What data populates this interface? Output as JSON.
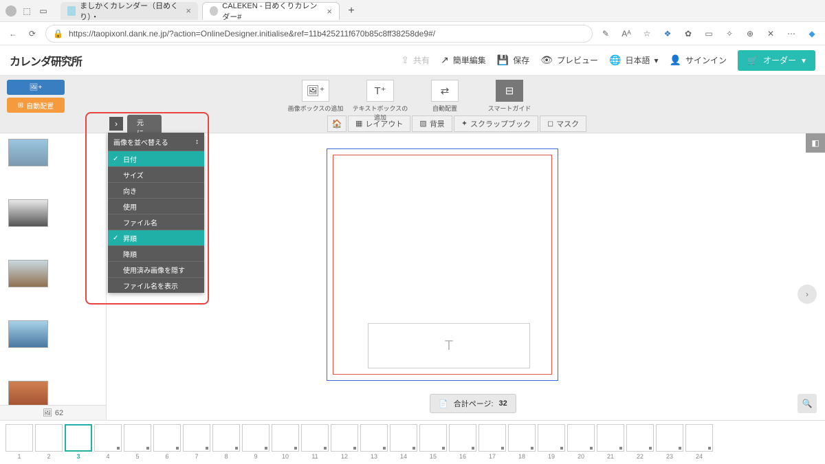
{
  "browser": {
    "tab1": "ましかくカレンダー（日めくり）・",
    "tab2": "CALEKEN - 日めくりカレンダー#",
    "url": "https://taopixonl.dank.ne.jp/?action=OnlineDesigner.initialise&ref=11b425211f670b85c8ff38258de9#/"
  },
  "appbar": {
    "logo": "カレンダ研究所",
    "share": "共有",
    "easy_edit": "簡単編集",
    "save": "保存",
    "preview": "プレビュー",
    "language": "日本語",
    "signin": "サインイン",
    "order": "オーダー"
  },
  "tools": {
    "add_imagebox": "画像ボックスの追加",
    "add_textbox": "テキストボックスの追加",
    "auto_layout": "自動配置",
    "smart_guide": "スマートガイド"
  },
  "leftbtn_auto": "自動配置",
  "subtabs": {
    "layout": "レイアウト",
    "background": "背景",
    "scrapbook": "スクラップブック",
    "mask": "マスク"
  },
  "image_count": "62",
  "revert_btn": "元に戻す",
  "sort_menu": {
    "header": "画像を並べ替える",
    "date": "日付",
    "size": "サイズ",
    "orientation": "向き",
    "usage": "使用",
    "filename": "ファイル名",
    "asc": "昇順",
    "desc": "降順",
    "hide_used": "使用済み画像を隠す",
    "show_filename": "ファイル名を表示"
  },
  "textframe_placeholder": "T",
  "pagecount": {
    "label": "合計ページ:",
    "value": "32"
  },
  "page_numbers": [
    "1",
    "2",
    "3",
    "4",
    "5",
    "6",
    "7",
    "8",
    "9",
    "10",
    "11",
    "12",
    "13",
    "14",
    "15",
    "16",
    "17",
    "18",
    "19",
    "20",
    "21",
    "22",
    "23",
    "24"
  ]
}
